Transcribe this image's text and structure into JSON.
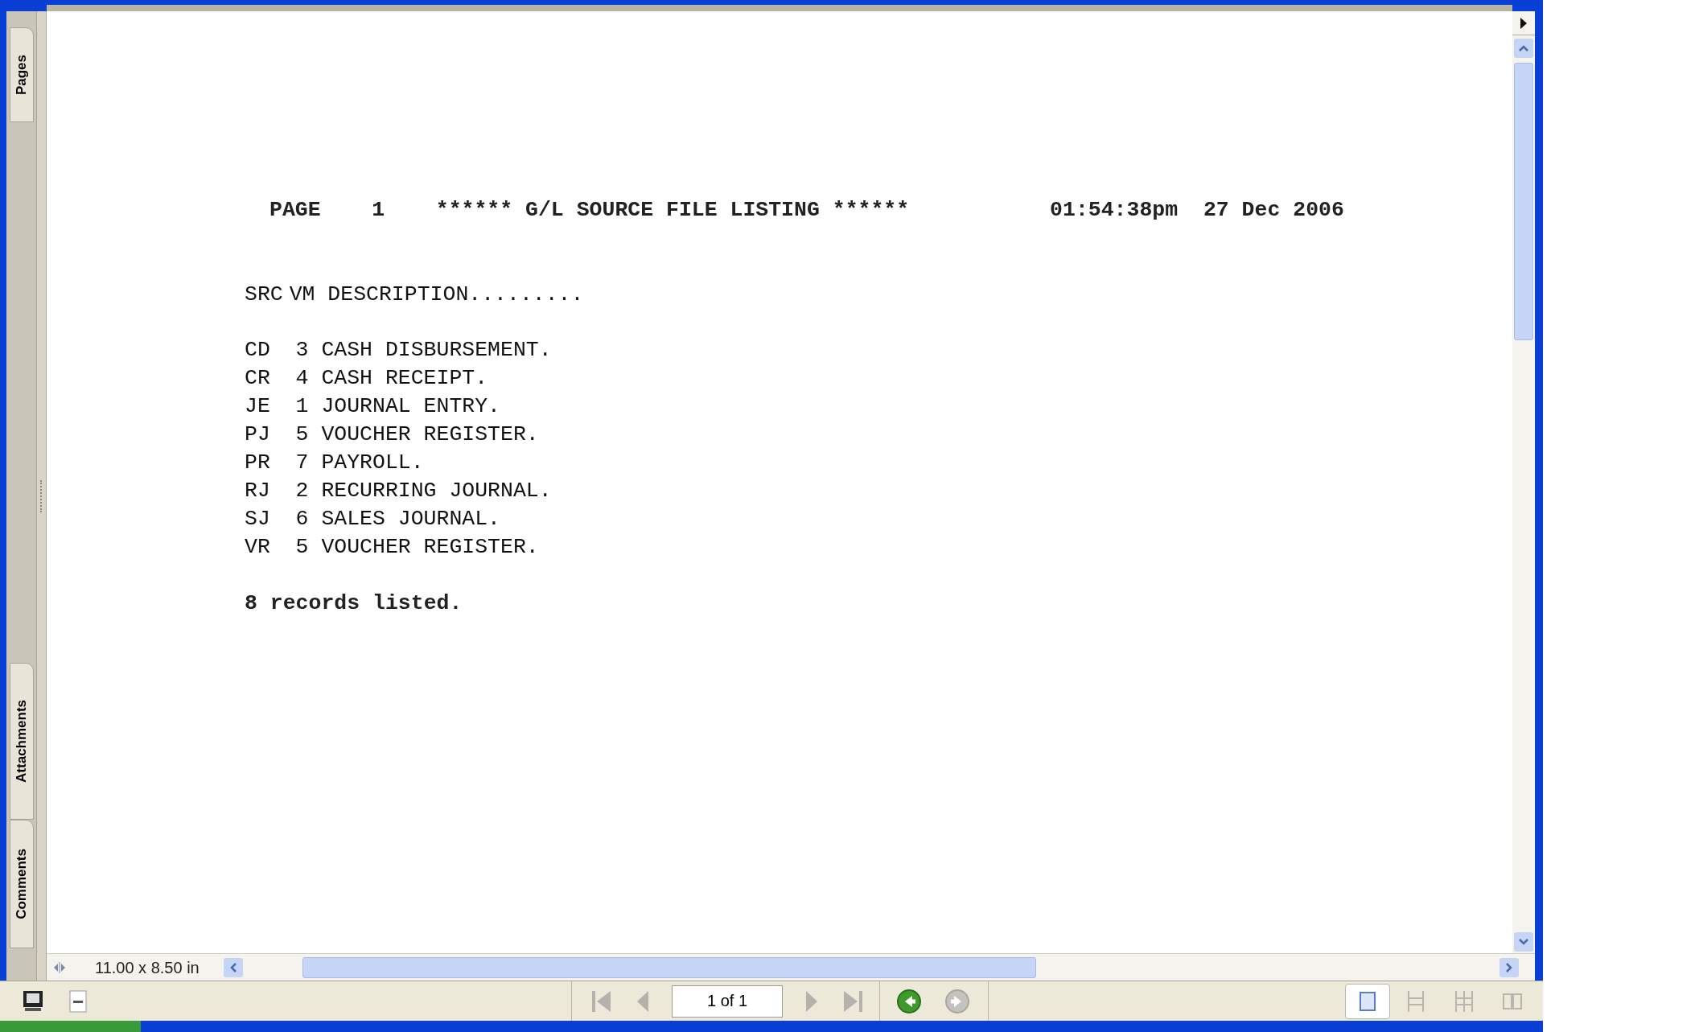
{
  "side_tabs": [
    {
      "label": "Pages"
    },
    {
      "label": "Attachments"
    },
    {
      "label": "Comments"
    }
  ],
  "document": {
    "header": {
      "page_label": "PAGE",
      "page_number": "1",
      "title": "****** G/L SOURCE FILE LISTING ******",
      "time": "01:54:38pm",
      "date": "27 Dec 2006"
    },
    "columns": [
      "SRC",
      "VM",
      "DESCRIPTION........."
    ],
    "rows": [
      {
        "src": "CD",
        "vm": "3",
        "description": "CASH DISBURSEMENT."
      },
      {
        "src": "CR",
        "vm": "4",
        "description": "CASH RECEIPT."
      },
      {
        "src": "JE",
        "vm": "1",
        "description": "JOURNAL ENTRY."
      },
      {
        "src": "PJ",
        "vm": "5",
        "description": "VOUCHER REGISTER."
      },
      {
        "src": "PR",
        "vm": "7",
        "description": "PAYROLL."
      },
      {
        "src": "RJ",
        "vm": "2",
        "description": "RECURRING JOURNAL."
      },
      {
        "src": "SJ",
        "vm": "6",
        "description": "SALES JOURNAL."
      },
      {
        "src": "VR",
        "vm": "5",
        "description": "VOUCHER REGISTER."
      }
    ],
    "footer": "8 records listed."
  },
  "page_size": "11.00 x 8.50 in",
  "nav_buttons": [
    {
      "kind": "first",
      "disabled": true
    },
    {
      "kind": "prev",
      "disabled": true
    },
    {
      "kind": "field",
      "value": "1 of 1"
    },
    {
      "kind": "next",
      "disabled": true
    },
    {
      "kind": "last",
      "disabled": true
    }
  ],
  "history_buttons": [
    {
      "kind": "back",
      "disabled": false
    },
    {
      "kind": "forward",
      "disabled": true
    }
  ],
  "view_buttons": [
    {
      "kind": "single",
      "selected": true
    },
    {
      "kind": "continuous",
      "selected": false
    },
    {
      "kind": "continuous-facing",
      "selected": false
    },
    {
      "kind": "facing",
      "selected": false
    }
  ]
}
